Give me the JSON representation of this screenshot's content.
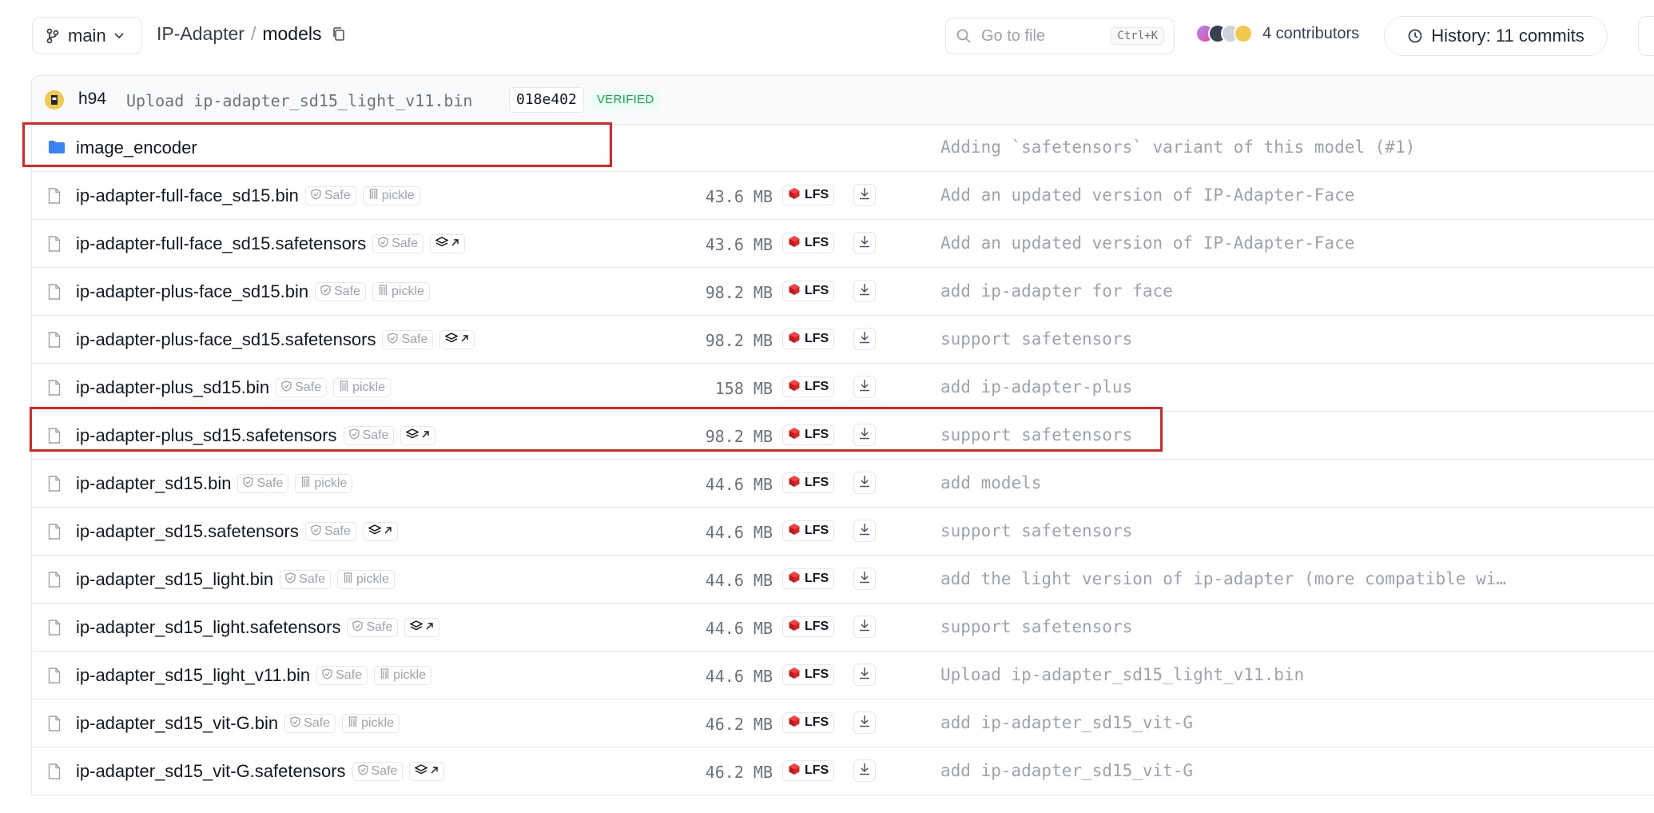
{
  "header": {
    "branch": "main",
    "breadcrumb": {
      "repo": "IP-Adapter",
      "sep": "/",
      "folder": "models"
    },
    "search": {
      "placeholder": "Go to file",
      "shortcut": "Ctrl+K"
    },
    "contributors_label": "4 contributors",
    "history_label": "History: 11 commits"
  },
  "last_commit": {
    "author": "h94",
    "message": "Upload ip-adapter_sd15_light_v11.bin",
    "hash": "018e402",
    "verified": "VERIFIED"
  },
  "folder": {
    "name": "image_encoder",
    "commit": "Adding `safetensors` variant of this model (#1)"
  },
  "files": [
    {
      "name": "ip-adapter-full-face_sd15.bin",
      "safe": "Safe",
      "extra": "pickle",
      "size": "43.6 MB",
      "lfs": "LFS",
      "commit": "Add an updated version of IP-Adapter-Face"
    },
    {
      "name": "ip-adapter-full-face_sd15.safetensors",
      "safe": "Safe",
      "extra": "",
      "size": "43.6 MB",
      "lfs": "LFS",
      "commit": "Add an updated version of IP-Adapter-Face"
    },
    {
      "name": "ip-adapter-plus-face_sd15.bin",
      "safe": "Safe",
      "extra": "pickle",
      "size": "98.2 MB",
      "lfs": "LFS",
      "commit": "add ip-adapter for face"
    },
    {
      "name": "ip-adapter-plus-face_sd15.safetensors",
      "safe": "Safe",
      "extra": "",
      "size": "98.2 MB",
      "lfs": "LFS",
      "commit": "support safetensors"
    },
    {
      "name": "ip-adapter-plus_sd15.bin",
      "safe": "Safe",
      "extra": "pickle",
      "size": "158 MB",
      "lfs": "LFS",
      "commit": "add ip-adapter-plus"
    },
    {
      "name": "ip-adapter-plus_sd15.safetensors",
      "safe": "Safe",
      "extra": "",
      "size": "98.2 MB",
      "lfs": "LFS",
      "commit": "support safetensors"
    },
    {
      "name": "ip-adapter_sd15.bin",
      "safe": "Safe",
      "extra": "pickle",
      "size": "44.6 MB",
      "lfs": "LFS",
      "commit": "add models"
    },
    {
      "name": "ip-adapter_sd15.safetensors",
      "safe": "Safe",
      "extra": "",
      "size": "44.6 MB",
      "lfs": "LFS",
      "commit": "support safetensors"
    },
    {
      "name": "ip-adapter_sd15_light.bin",
      "safe": "Safe",
      "extra": "pickle",
      "size": "44.6 MB",
      "lfs": "LFS",
      "commit": "add the light version of ip-adapter (more compatible wit…"
    },
    {
      "name": "ip-adapter_sd15_light.safetensors",
      "safe": "Safe",
      "extra": "",
      "size": "44.6 MB",
      "lfs": "LFS",
      "commit": "support safetensors"
    },
    {
      "name": "ip-adapter_sd15_light_v11.bin",
      "safe": "Safe",
      "extra": "pickle",
      "size": "44.6 MB",
      "lfs": "LFS",
      "commit": "Upload ip-adapter_sd15_light_v11.bin"
    },
    {
      "name": "ip-adapter_sd15_vit-G.bin",
      "safe": "Safe",
      "extra": "pickle",
      "size": "46.2 MB",
      "lfs": "LFS",
      "commit": "add ip-adapter_sd15_vit-G"
    },
    {
      "name": "ip-adapter_sd15_vit-G.safetensors",
      "safe": "Safe",
      "extra": "",
      "size": "46.2 MB",
      "lfs": "LFS",
      "commit": "add ip-adapter_sd15_vit-G"
    }
  ],
  "colors": {
    "highlight": "#e02424",
    "lfs_icon": "#dc2626",
    "folder_icon": "#3b82f6",
    "verified": "#16a34a"
  }
}
